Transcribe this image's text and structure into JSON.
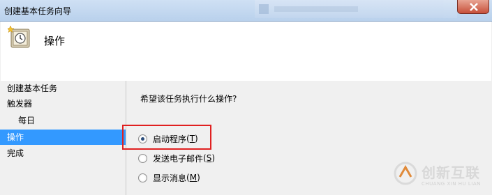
{
  "window": {
    "title": "创建基本任务向导",
    "close_icon": "close-icon"
  },
  "header": {
    "title": "操作",
    "icon": "task-clock-icon"
  },
  "sidebar": {
    "items": [
      {
        "label": "创建基本任务",
        "selected": false,
        "sub": false
      },
      {
        "label": "触发器",
        "selected": false,
        "sub": false
      },
      {
        "label": "每日",
        "selected": false,
        "sub": true
      },
      {
        "label": "操作",
        "selected": true,
        "sub": false
      },
      {
        "label": "完成",
        "selected": false,
        "sub": false
      }
    ]
  },
  "main": {
    "question": "希望该任务执行什么操作?",
    "options": [
      {
        "label": "启动程序",
        "accel": "T",
        "checked": true
      },
      {
        "label": "发送电子邮件",
        "accel": "S",
        "checked": false
      },
      {
        "label": "显示消息",
        "accel": "M",
        "checked": false
      }
    ]
  },
  "watermark": {
    "text": "创新互联",
    "sub": "CHUANG XIN HU LIAN"
  },
  "colors": {
    "selection": "#3399ff",
    "highlight_border": "#e02020",
    "titlebar": "#cfe0f4"
  }
}
